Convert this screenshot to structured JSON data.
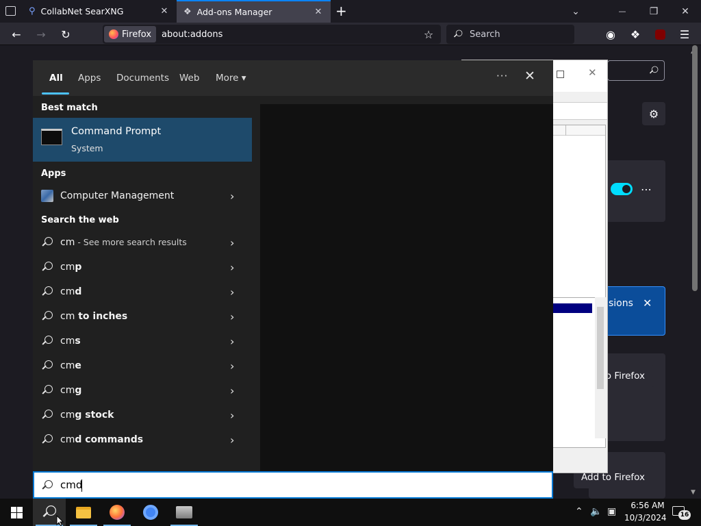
{
  "browser": {
    "tabs": [
      {
        "label": "CollabNet SearXNG",
        "close": "✕"
      },
      {
        "label": "Add-ons Manager",
        "close": "✕"
      }
    ],
    "new_tab": "+",
    "identity_label": "Firefox",
    "url": "about:addons",
    "search_placeholder": "Search",
    "window_controls": {
      "minimize": "—",
      "restore": "❐",
      "close": "✕"
    }
  },
  "addons_page": {
    "banner_text": "sions",
    "banner_close": "✕",
    "add_button_1": "o Firefox",
    "add_button_2": "Add to Firefox"
  },
  "search_panel": {
    "tabs": [
      "All",
      "Apps",
      "Documents",
      "Web",
      "More ▾"
    ],
    "options": "···",
    "close": "✕",
    "best_match": {
      "heading": "Best match",
      "title": "Command Prompt",
      "subtitle": "System"
    },
    "apps": {
      "heading": "Apps",
      "items": [
        {
          "label": "Computer Management"
        }
      ]
    },
    "web": {
      "heading": "Search the web",
      "first": {
        "query": "cm",
        "hint": " - See more search results"
      },
      "items": [
        {
          "prefix": "cm",
          "bold": "p"
        },
        {
          "prefix": "cm",
          "bold": "d"
        },
        {
          "prefix": "cm",
          "bold": " to inches"
        },
        {
          "prefix": "cm",
          "bold": "s"
        },
        {
          "prefix": "cm",
          "bold": "e"
        },
        {
          "prefix": "cm",
          "bold": "g"
        },
        {
          "prefix": "cm",
          "bold": "g stock"
        },
        {
          "prefix": "cm",
          "bold": "d commands"
        }
      ]
    },
    "arrow": "›"
  },
  "search_box": {
    "value": "cmd"
  },
  "taskbar": {
    "time": "6:56 AM",
    "date": "10/3/2024",
    "notification_count": "16"
  }
}
